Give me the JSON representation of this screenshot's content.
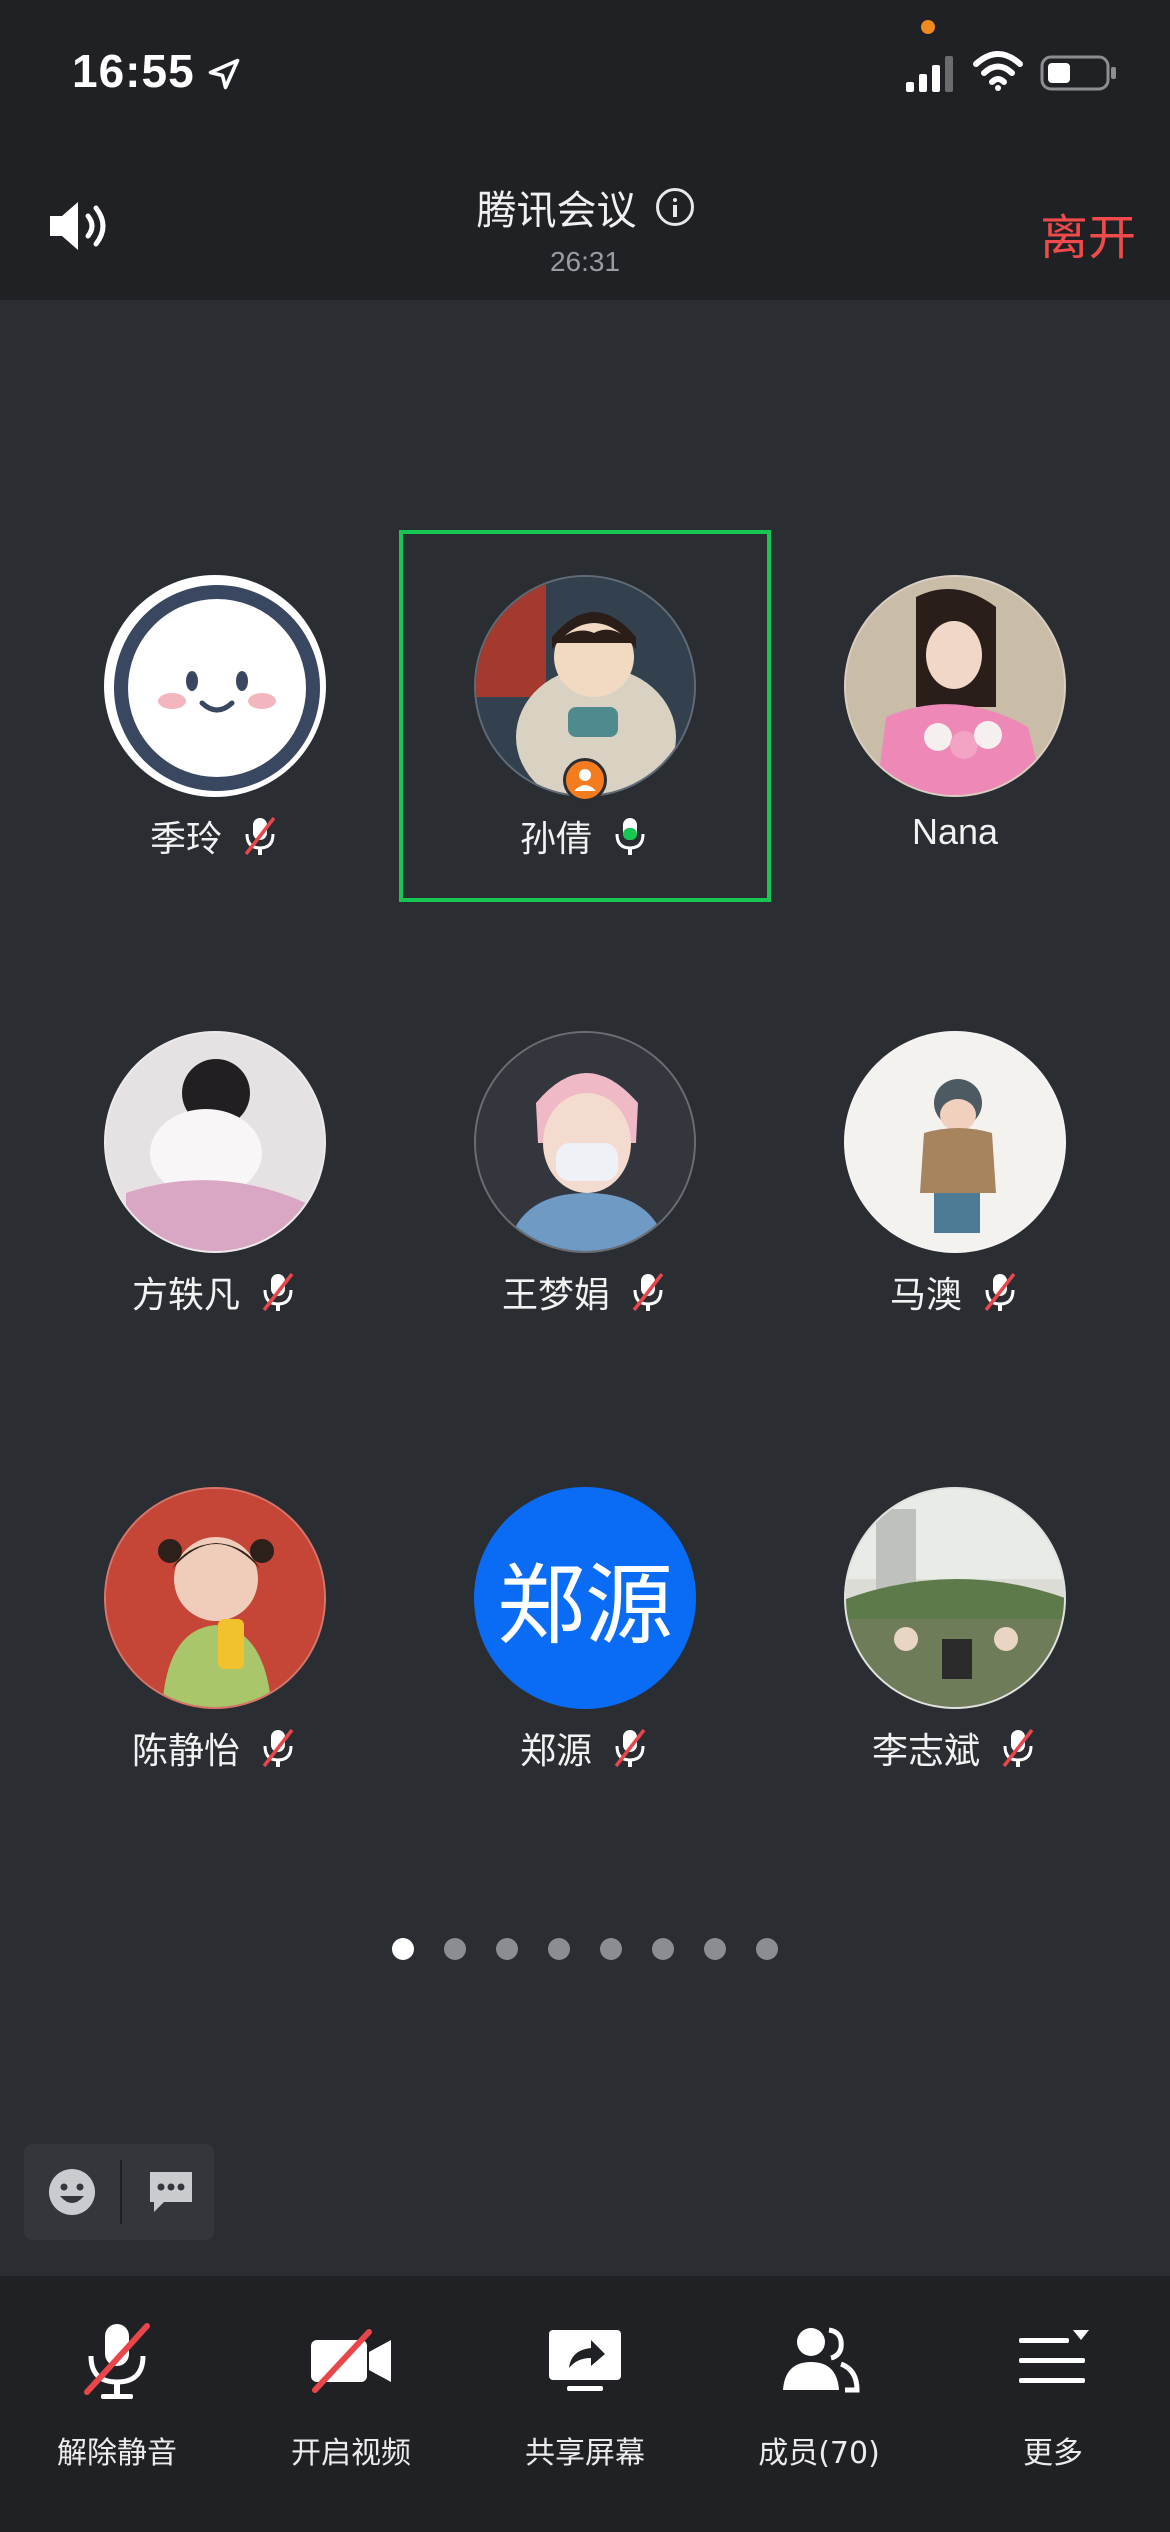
{
  "status_bar": {
    "time": "16:55"
  },
  "header": {
    "title": "腾讯会议",
    "timer": "26:31",
    "leave_label": "离开"
  },
  "participants": [
    {
      "name": "季玲",
      "muted": true
    },
    {
      "name": "孙倩",
      "muted": false,
      "speaking": true,
      "host": true
    },
    {
      "name": "Nana"
    },
    {
      "name": "方轶凡",
      "muted": true
    },
    {
      "name": "王梦娟",
      "muted": true
    },
    {
      "name": "马澳",
      "muted": true
    },
    {
      "name": "陈静怡",
      "muted": true
    },
    {
      "name": "郑源",
      "muted": true,
      "avatar_text": "郑源"
    },
    {
      "name": "李志斌",
      "muted": true
    }
  ],
  "pager": {
    "pages": 8,
    "current": 1
  },
  "toolbar": {
    "unmute_label": "解除静音",
    "video_label": "开启视频",
    "share_label": "共享屏幕",
    "members_label": "成员(70)",
    "more_label": "更多"
  },
  "colors": {
    "accent_green": "#17c653",
    "leave_red": "#f04a4a",
    "text_avatar_blue": "#0a6cf5",
    "host_badge_orange": "#f57c1e"
  }
}
